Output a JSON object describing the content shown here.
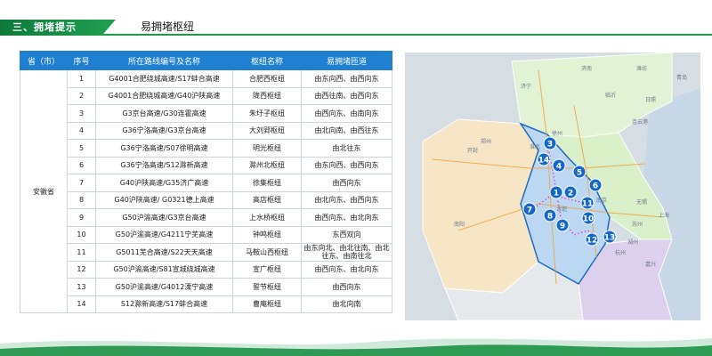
{
  "header": {
    "section_label": "三、拥堵提示",
    "title": "易拥堵枢纽"
  },
  "table": {
    "columns": [
      "省（市）",
      "序号",
      "所在路线编号及名称",
      "枢纽名称",
      "易拥堵匝道"
    ],
    "province": "安徽省",
    "rows": [
      {
        "no": "1",
        "route": "G4001合肥绕城高速/S17蚌合高速",
        "hub": "合肥西枢纽",
        "ramp": "由东向西、由西向东"
      },
      {
        "no": "2",
        "route": "G4001合肥绕城高速/G40沪陕高速",
        "hub": "陇西枢纽",
        "ramp": "由西往南、由西向东"
      },
      {
        "no": "3",
        "route": "G3京台高速/G30连霍高速",
        "hub": "朱圩子枢纽",
        "ramp": "由西向东、由南向东"
      },
      {
        "no": "4",
        "route": "G36宁洛高速/G3京台高速",
        "hub": "大刘郢枢纽",
        "ramp": "由北向南、由西往东"
      },
      {
        "no": "5",
        "route": "G36宁洛高速/S07徐明高速",
        "hub": "明光枢纽",
        "ramp": "由北往东"
      },
      {
        "no": "6",
        "route": "G36宁洛高速/S12滁新高速",
        "hub": "滁州北枢纽",
        "ramp": "由东向西、由西向东"
      },
      {
        "no": "7",
        "route": "G40沪陕高速/G35济广高速",
        "hub": "徐集枢纽",
        "ramp": "由西向东"
      },
      {
        "no": "8",
        "route": "G40沪陕高速/ G0321德上高速",
        "hub": "高店枢纽",
        "ramp": "由北向东、由西向东"
      },
      {
        "no": "9",
        "route": "G50沪渝高速/G3京台高速",
        "hub": "上水桥枢纽",
        "ramp": "由西向东、由北向东"
      },
      {
        "no": "10",
        "route": "G50沪渝高速/G4211宁芜高速",
        "hub": "钟鸣枢纽",
        "ramp": "东西双向"
      },
      {
        "no": "11",
        "route": "G5011芜合高速/S22天天高速",
        "hub": "马鞍山西枢纽",
        "ramp": "由东向北、由北往南、由北往东、由南往北"
      },
      {
        "no": "12",
        "route": "G50沪渝高速/S81宣城绕城高速",
        "hub": "宣广枢纽",
        "ramp": "由西向东、由北向东"
      },
      {
        "no": "13",
        "route": "G50沪渝高速/G4012溧宁高速",
        "hub": "誓节枢纽",
        "ramp": "由西向东"
      },
      {
        "no": "14",
        "route": "S12滁新高速/S17蚌合高速",
        "hub": "曹庵枢纽",
        "ramp": "由北向南"
      }
    ]
  },
  "map": {
    "markers": [
      "1",
      "2",
      "3",
      "4",
      "5",
      "6",
      "7",
      "8",
      "9",
      "10",
      "11",
      "12",
      "13",
      "14"
    ],
    "cities": [
      "济南",
      "郑州",
      "南阳",
      "合肥",
      "南京",
      "上海",
      "杭州",
      "苏州",
      "徐州",
      "连云港",
      "开封",
      "淮北",
      "湖州",
      "无锡",
      "济宁",
      "临沂",
      "日照",
      "青岛",
      "潍坊",
      "嘉兴"
    ],
    "colors": {
      "anhui": "#bcd7f2",
      "henan": "#f7e6c5",
      "jiangsu": "#d9f0c8",
      "zhejiang": "#dcd0ec",
      "shandong": "#e1f3d4",
      "marker": "#1468c8",
      "route": "#ff00cc"
    }
  }
}
